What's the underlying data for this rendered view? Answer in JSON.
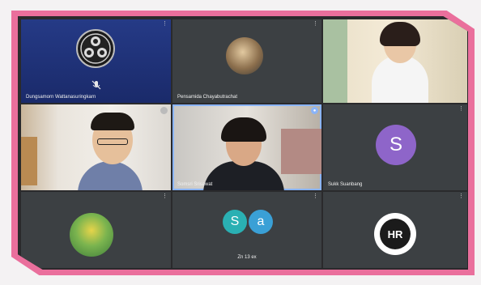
{
  "participants": [
    {
      "name": "Dungsamorn Wattanasuringkarn",
      "type": "logo",
      "icon": "obs-logo-icon",
      "muted": true
    },
    {
      "name": "Pensamida Chayabutrachat",
      "type": "avatar-photo",
      "avatar_color": "#9a8a6c"
    },
    {
      "name": "",
      "type": "video"
    },
    {
      "name": "",
      "type": "video"
    },
    {
      "name": "Somsri Srisawat",
      "type": "video",
      "active": true
    },
    {
      "name": "Sukk Suanbang",
      "type": "initial",
      "initial": "S",
      "avatar_color": "#8e65c9"
    },
    {
      "name": "",
      "type": "avatar-photo",
      "avatar_color": "#4fa34a"
    },
    {
      "name": "Zn 13 ex",
      "type": "initials-pair",
      "initials": [
        "S",
        "a"
      ],
      "avatar_color": "#2ab0b3"
    },
    {
      "name": "",
      "type": "logo",
      "label": "HR"
    }
  ],
  "colors": {
    "frame": "#ea6f9c",
    "tile": "#3c4043",
    "active_outline": "#8ab4f8"
  }
}
